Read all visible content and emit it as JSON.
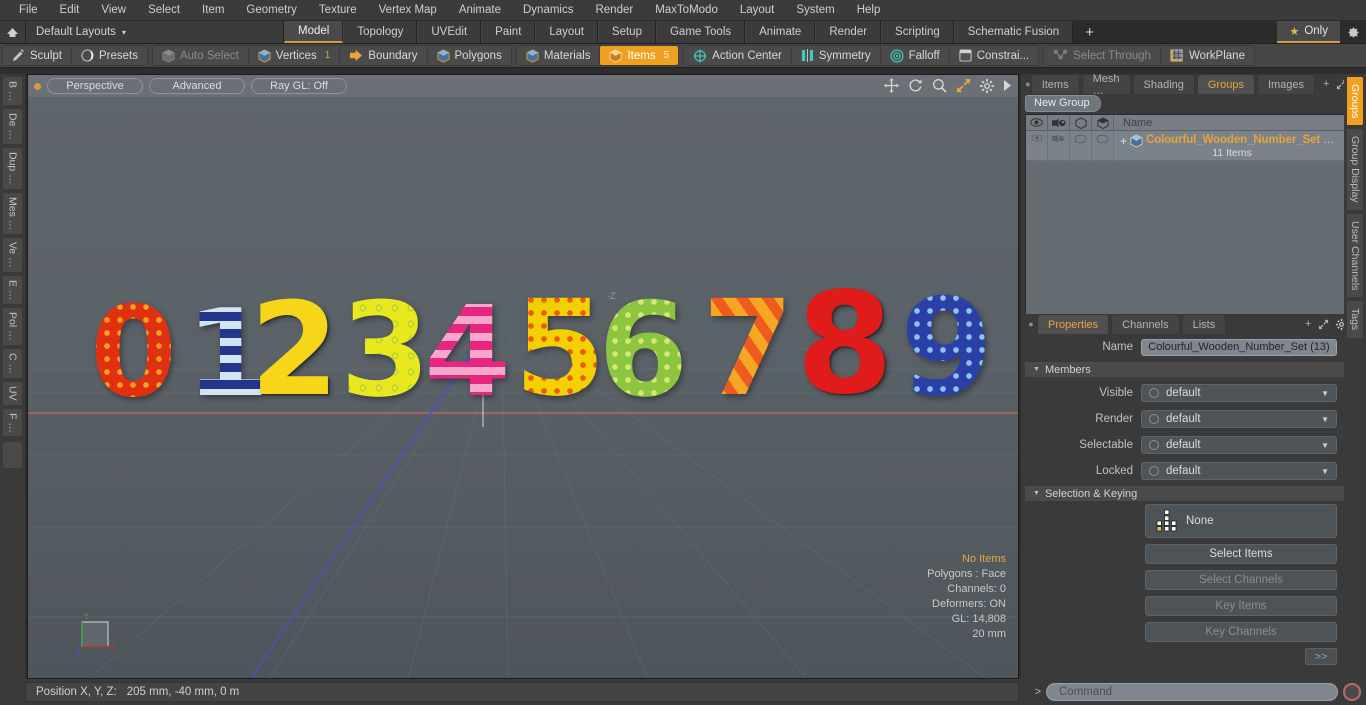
{
  "menubar": {
    "items": [
      "File",
      "Edit",
      "View",
      "Select",
      "Item",
      "Geometry",
      "Texture",
      "Vertex Map",
      "Animate",
      "Dynamics",
      "Render",
      "MaxToModo",
      "Layout",
      "System",
      "Help"
    ]
  },
  "layoutbar": {
    "home_icon": "home-icon",
    "layout_name": "Default Layouts",
    "caret": "▾",
    "tabs": [
      {
        "label": "Model",
        "active": true
      },
      {
        "label": "Topology",
        "active": false
      },
      {
        "label": "UVEdit",
        "active": false
      },
      {
        "label": "Paint",
        "active": false
      },
      {
        "label": "Layout",
        "active": false
      },
      {
        "label": "Setup",
        "active": false
      },
      {
        "label": "Game Tools",
        "active": false
      },
      {
        "label": "Animate",
        "active": false
      },
      {
        "label": "Render",
        "active": false
      },
      {
        "label": "Scripting",
        "active": false
      },
      {
        "label": "Schematic Fusion",
        "active": false
      }
    ],
    "add_tab_label": "+",
    "only_label": "Only",
    "only_star": "★",
    "gear_icon": "gear-icon"
  },
  "modebar": {
    "left_group": [
      {
        "label": "Sculpt",
        "icon": "pencil-icon",
        "state": "normal"
      },
      {
        "label": "Presets",
        "icon": "sphere-icon",
        "state": "normal"
      }
    ],
    "select_group": [
      {
        "label": "Auto Select",
        "icon": "cube-grey-icon",
        "state": "dim",
        "count": ""
      },
      {
        "label": "Vertices",
        "icon": "cube-blue-icon",
        "state": "normal",
        "count": "1"
      },
      {
        "label": "Boundary",
        "icon": "boundary-icon",
        "state": "normal",
        "count": ""
      },
      {
        "label": "Polygons",
        "icon": "cube-blue-icon",
        "state": "normal",
        "count": ""
      }
    ],
    "mat_group": [
      {
        "label": "Materials",
        "icon": "cube-blue-icon",
        "state": "normal",
        "count": ""
      },
      {
        "label": "Items",
        "icon": "cube-orange-icon",
        "state": "selected",
        "count": "5"
      }
    ],
    "tool_group": [
      {
        "label": "Action Center",
        "icon": "crosshair-icon",
        "state": "normal"
      },
      {
        "label": "Symmetry",
        "icon": "symmetry-icon",
        "state": "normal"
      },
      {
        "label": "Falloff",
        "icon": "falloff-icon",
        "state": "normal"
      },
      {
        "label": "Constrai...",
        "icon": "constraint-icon",
        "state": "normal"
      }
    ],
    "right_group": [
      {
        "label": "Select Through",
        "icon": "select-through-icon",
        "state": "dim"
      },
      {
        "label": "WorkPlane",
        "icon": "workplane-icon",
        "state": "normal"
      }
    ]
  },
  "left_toolbox": {
    "tabs": [
      "B …",
      "De …",
      "Dup …",
      "Mes …",
      "Ve …",
      "E …",
      "Pol …",
      "C …",
      "UV",
      "F …"
    ]
  },
  "viewport": {
    "pills": [
      "Perspective",
      "Advanced",
      "Ray GL: Off"
    ],
    "icons": [
      "move-icon",
      "rotate-icon",
      "zoom-icon",
      "fit-icon",
      "gear-icon",
      "arrow-right-icon"
    ],
    "stats": [
      {
        "text": "No Items",
        "highlight": true
      },
      {
        "text": "Polygons : Face",
        "highlight": false
      },
      {
        "text": "Channels: 0",
        "highlight": false
      },
      {
        "text": "Deformers: ON",
        "highlight": false
      },
      {
        "text": "GL: 14,808",
        "highlight": false
      },
      {
        "text": "20 mm",
        "highlight": false
      }
    ],
    "axis_labels": {
      "x": "X",
      "y": "Y",
      "z": "Z"
    },
    "z_axis_marker": "-Z",
    "scene_objects": [
      {
        "digit": "0",
        "color": "#e03010",
        "accent": "#f7a020",
        "pattern": "dots"
      },
      {
        "digit": "1",
        "color": "#24358c",
        "accent": "#cfe4f5",
        "pattern": "stripes-h"
      },
      {
        "digit": "2",
        "color": "#f7d518",
        "accent": "#f7d518",
        "pattern": "plain"
      },
      {
        "digit": "3",
        "color": "#e8e81c",
        "accent": "#b9d040",
        "pattern": "swirls"
      },
      {
        "digit": "4",
        "color": "#e8267f",
        "accent": "#f9a8cd",
        "pattern": "stripes-h"
      },
      {
        "digit": "5",
        "color": "#f5d000",
        "accent": "#e85a10",
        "pattern": "dots"
      },
      {
        "digit": "6",
        "color": "#8cc63f",
        "accent": "#d4e87a",
        "pattern": "dots"
      },
      {
        "digit": "7",
        "color": "#f5a623",
        "accent": "#ef5a1e",
        "pattern": "stripes-diag"
      },
      {
        "digit": "8",
        "color": "#e01b1b",
        "accent": "#e01b1b",
        "pattern": "plain"
      },
      {
        "digit": "9",
        "color": "#2b3fa8",
        "accent": "#8ec3f0",
        "pattern": "dots"
      }
    ]
  },
  "right_panel": {
    "top_tabs": [
      {
        "label": "Items",
        "active": false
      },
      {
        "label": "Mesh …",
        "active": false
      },
      {
        "label": "Shading",
        "active": false
      },
      {
        "label": "Groups",
        "active": true
      },
      {
        "label": "Images",
        "active": false
      }
    ],
    "top_tab_plus": "+",
    "new_group_button": "New Group",
    "list_header": {
      "name_col": "Name",
      "icons": [
        "eye-icon",
        "render-icon",
        "cube-outline-icon",
        "cube-shaded-icon"
      ]
    },
    "list_rows": [
      {
        "expand": "+",
        "icon": "group-icon",
        "title": "Colourful_Wooden_Number_Set",
        "ellipsis": "…",
        "subtitle": "11 Items"
      }
    ],
    "prop_tabs": [
      {
        "label": "Properties",
        "active": true
      },
      {
        "label": "Channels",
        "active": false
      },
      {
        "label": "Lists",
        "active": false
      }
    ],
    "prop_tab_plus": "+",
    "name_label": "Name",
    "name_value": "Colourful_Wooden_Number_Set (13)",
    "members_section": "Members",
    "members": [
      {
        "label": "Visible",
        "value": "default"
      },
      {
        "label": "Render",
        "value": "default"
      },
      {
        "label": "Selectable",
        "value": "default"
      },
      {
        "label": "Locked",
        "value": "default"
      }
    ],
    "selection_section": "Selection & Keying",
    "selection_value": "None",
    "selection_buttons": [
      {
        "label": "Select Items",
        "enabled": true
      },
      {
        "label": "Select Channels",
        "enabled": false
      },
      {
        "label": "Key Items",
        "enabled": false
      },
      {
        "label": "Key Channels",
        "enabled": false
      }
    ],
    "expand_button": ">>",
    "side_tabs": [
      {
        "label": "Groups",
        "active": true
      },
      {
        "label": "Group Display",
        "active": false
      },
      {
        "label": "User Channels",
        "active": false
      },
      {
        "label": "Tags",
        "active": false
      }
    ]
  },
  "bottombar": {
    "position_label": "Position X, Y, Z:",
    "position_value": "205 mm,  -40 mm,  0 m",
    "command_arrow": ">",
    "command_placeholder": "Command",
    "record_icon": "record-icon"
  },
  "colors": {
    "accent_orange": "#f0a020",
    "tab_orange": "#e8a33c",
    "panel_bg": "#3a3a3a",
    "viewport_bg": "#5b6268"
  }
}
